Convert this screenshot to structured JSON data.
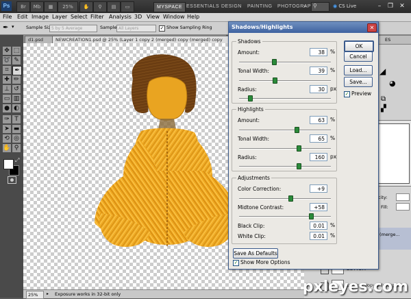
{
  "appbar": {
    "logo": "Ps",
    "zoom": "25%",
    "workspaces": [
      "MYSPACE",
      "ESSENTIALS",
      "DESIGN",
      "PAINTING",
      "PHOTOGRAPHY"
    ],
    "cs_live": "CS Live",
    "more_glyph": "»"
  },
  "menu": [
    "File",
    "Edit",
    "Image",
    "Layer",
    "Select",
    "Filter",
    "Analysis",
    "3D",
    "View",
    "Window",
    "Help"
  ],
  "options": {
    "sample_size_label": "Sample Size:",
    "sample_size_value": "5 by 5 Average",
    "sample_label": "Sample:",
    "sample_value": "All Layers",
    "sampling_ring_label": "Show Sampling Ring",
    "sampling_ring_checked": true
  },
  "tabs": [
    "d1.psd",
    "NEWCREATION1.psd @ 25% (Layer 1 copy 2 (merged) copy (merged) copy"
  ],
  "status": {
    "zoom": "25%",
    "message": "Exposure works in 32-bit only"
  },
  "right_panel": {
    "partial_labels": [
      "ES",
      "city:",
      "Fill:",
      "(merge...",
      "BOTTOM",
      "Layer 1 copy 2 (merged)"
    ]
  },
  "dialog": {
    "title": "Shadows/Highlights",
    "close_glyph": "✕",
    "shadows": {
      "legend": "Shadows",
      "amount": {
        "label": "Amount:",
        "value": "38",
        "unit": "%",
        "level": 0.38
      },
      "tonal_width": {
        "label": "Tonal Width:",
        "value": "39",
        "unit": "%",
        "level": 0.39
      },
      "radius": {
        "label": "Radius:",
        "value": "30",
        "unit": "px",
        "level": 0.12
      }
    },
    "highlights": {
      "legend": "Highlights",
      "amount": {
        "label": "Amount:",
        "value": "63",
        "unit": "%",
        "level": 0.63
      },
      "tonal_width": {
        "label": "Tonal Width:",
        "value": "65",
        "unit": "%",
        "level": 0.65
      },
      "radius": {
        "label": "Radius:",
        "value": "160",
        "unit": "px",
        "level": 0.65
      }
    },
    "adjustments": {
      "legend": "Adjustments",
      "color_correction": {
        "label": "Color Correction:",
        "value": "+9",
        "level": 0.56
      },
      "midtone_contrast": {
        "label": "Midtone Contrast:",
        "value": "+58",
        "level": 0.78
      },
      "black_clip": {
        "label": "Black Clip:",
        "value": "0.01",
        "unit": "%"
      },
      "white_clip": {
        "label": "White Clip:",
        "value": "0.01",
        "unit": "%"
      }
    },
    "buttons": {
      "ok": "OK",
      "cancel": "Cancel",
      "load": "Load...",
      "save": "Save...",
      "save_defaults": "Save As Defaults"
    },
    "preview": {
      "label": "Preview",
      "checked": true
    },
    "show_more": {
      "label": "Show More Options",
      "checked": true
    }
  },
  "watermark": "pxleyes.com",
  "colors": {
    "accent": "#3e62a0",
    "slider_thumb": "#2a8a3a",
    "figure_gold": "#e8a020",
    "hair": "#6b3d12"
  }
}
